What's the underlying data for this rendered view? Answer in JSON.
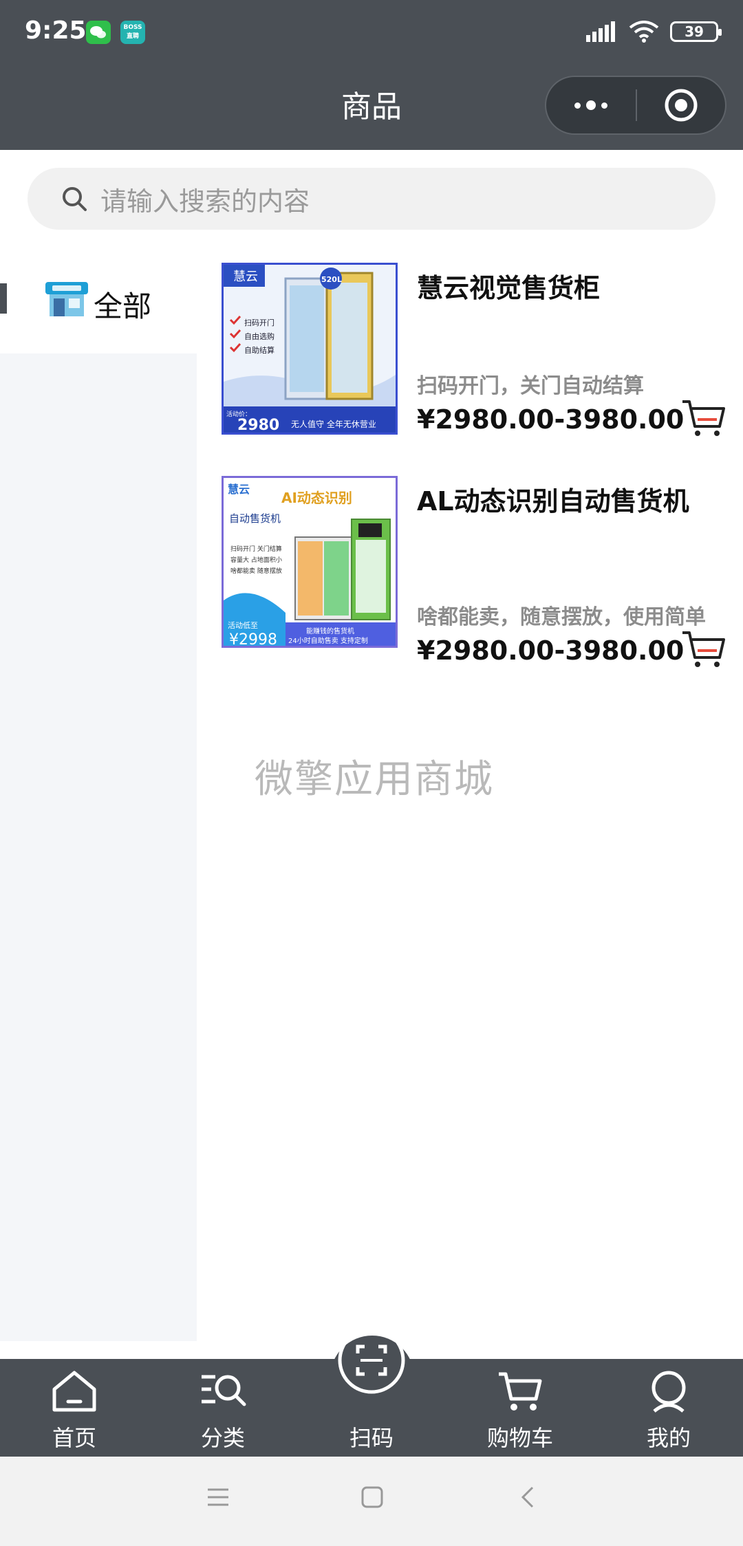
{
  "status": {
    "time": "9:25",
    "battery": "39",
    "app_wechat": "",
    "app_boss": "BOSS\n直聘"
  },
  "header": {
    "title": "商品"
  },
  "search": {
    "placeholder": "请输入搜索的内容"
  },
  "sidebar": {
    "items": [
      {
        "label": "全部",
        "icon": "store-icon",
        "active": true
      }
    ]
  },
  "products": [
    {
      "title": "慧云视觉售货柜",
      "desc": "扫码开门，关门自动结算",
      "price": "¥2980.00-3980.00",
      "image": {
        "brand": "慧云",
        "capacity": "520L",
        "features": [
          "扫码开门",
          "自由选购",
          "自助结算"
        ],
        "promo_label": "活动价：",
        "promo_price": "2980",
        "footer": "无人值守  全年无休营业"
      }
    },
    {
      "title": "AL动态识别自动售货机",
      "desc": "啥都能卖，随意摆放，使用简单",
      "price": "¥2980.00-3980.00",
      "image": {
        "brand": "慧云",
        "headline": "AI动态识别",
        "subhead": "自动售货机",
        "features": [
          "扫码开门 关门结算",
          "容量大  占地面积小",
          "啥都能卖 随意摆放"
        ],
        "promo_label": "活动低至",
        "promo_price": "2998",
        "footer1": "能赚钱的售货机",
        "footer2": "24小时自助售卖 支持定制"
      }
    }
  ],
  "watermark": "微擎应用商城",
  "tabbar": {
    "items": [
      {
        "label": "首页",
        "icon": "home-icon"
      },
      {
        "label": "分类",
        "icon": "category-search-icon"
      },
      {
        "label": "扫码",
        "icon": "scan-icon"
      },
      {
        "label": "购物车",
        "icon": "cart-icon"
      },
      {
        "label": "我的",
        "icon": "profile-icon"
      }
    ]
  },
  "colors": {
    "header_bg": "#4a4f55",
    "sidebar_bg": "#f4f6f9",
    "cart_accent": "#e74c3c"
  }
}
